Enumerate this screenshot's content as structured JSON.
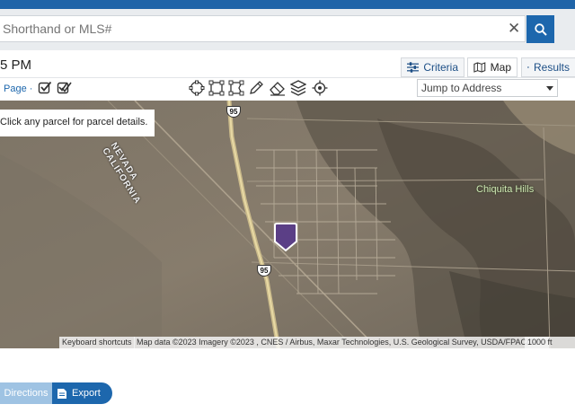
{
  "search": {
    "placeholder": "Shorthand or MLS#",
    "value": ""
  },
  "header": {
    "time_text": "5 PM"
  },
  "tabs": [
    {
      "label": "Criteria",
      "icon": "sliders-icon"
    },
    {
      "label": "Map",
      "icon": "map-icon"
    },
    {
      "label": "Results",
      "icon": "grid-icon"
    }
  ],
  "toolbar": {
    "page_link": "Page ·",
    "jump_select": "Jump to Address"
  },
  "map": {
    "tooltip": "Click any parcel for parcel details.",
    "labels": {
      "state_line": "NEVADA CALIFORNIA",
      "hills": "Chiquita Hills",
      "route_top": "95",
      "route_bottom": "95"
    },
    "attribution": {
      "shortcuts": "Keyboard shortcuts",
      "map_data": "Map data ©2023 Imagery ©2023 , CNES / Airbus, Maxar Technologies, U.S. Geological Survey, USDA/FPAC/GEO",
      "scale": "1000 ft"
    }
  },
  "actions": {
    "directions": "Directions",
    "export": "Export"
  },
  "colors": {
    "brand": "#1d67ad",
    "marker": "#5b3f86"
  }
}
